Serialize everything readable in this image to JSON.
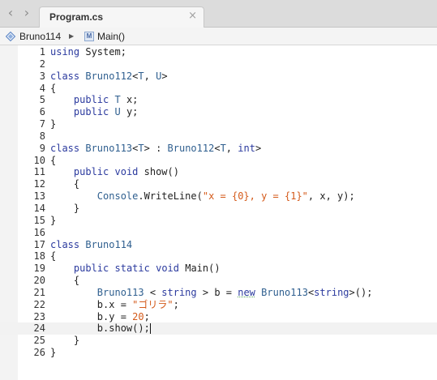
{
  "tabbar": {
    "back_glyph": "‹",
    "forward_glyph": "›",
    "tab_title": "Program.cs",
    "close_glyph": "×"
  },
  "breadcrumb": {
    "namespace": "Bruno114",
    "separator": "▶",
    "method": "Main()",
    "icons": [
      "namespace-icon",
      "method-icon"
    ]
  },
  "colors": {
    "keyword": "#2b3a9e",
    "type": "#2f5f8f",
    "string": "#d45a1a",
    "number": "#d45a1a",
    "plain": "#222222"
  },
  "editor": {
    "current_line": 24,
    "lines": [
      {
        "n": "1",
        "tokens": [
          [
            "kw",
            "using"
          ],
          [
            "p",
            " System;"
          ]
        ]
      },
      {
        "n": "2",
        "tokens": []
      },
      {
        "n": "3",
        "tokens": [
          [
            "kw",
            "class"
          ],
          [
            "p",
            " "
          ],
          [
            "ty",
            "Bruno112"
          ],
          [
            "p",
            "<"
          ],
          [
            "ty",
            "T"
          ],
          [
            "p",
            ", "
          ],
          [
            "ty",
            "U"
          ],
          [
            "p",
            ">"
          ]
        ]
      },
      {
        "n": "4",
        "tokens": [
          [
            "p",
            "{"
          ]
        ]
      },
      {
        "n": "5",
        "tokens": [
          [
            "p",
            "    "
          ],
          [
            "kw",
            "public"
          ],
          [
            "p",
            " "
          ],
          [
            "ty",
            "T"
          ],
          [
            "p",
            " x;"
          ]
        ]
      },
      {
        "n": "6",
        "tokens": [
          [
            "p",
            "    "
          ],
          [
            "kw",
            "public"
          ],
          [
            "p",
            " "
          ],
          [
            "ty",
            "U"
          ],
          [
            "p",
            " y;"
          ]
        ]
      },
      {
        "n": "7",
        "tokens": [
          [
            "p",
            "}"
          ]
        ]
      },
      {
        "n": "8",
        "tokens": []
      },
      {
        "n": "9",
        "tokens": [
          [
            "kw",
            "class"
          ],
          [
            "p",
            " "
          ],
          [
            "ty",
            "Bruno113"
          ],
          [
            "p",
            "<"
          ],
          [
            "ty",
            "T"
          ],
          [
            "p",
            "> : "
          ],
          [
            "ty",
            "Bruno112"
          ],
          [
            "p",
            "<"
          ],
          [
            "ty",
            "T"
          ],
          [
            "p",
            ", "
          ],
          [
            "kw",
            "int"
          ],
          [
            "p",
            ">"
          ]
        ]
      },
      {
        "n": "10",
        "tokens": [
          [
            "p",
            "{"
          ]
        ]
      },
      {
        "n": "11",
        "tokens": [
          [
            "p",
            "    "
          ],
          [
            "kw",
            "public"
          ],
          [
            "p",
            " "
          ],
          [
            "kw",
            "void"
          ],
          [
            "p",
            " show()"
          ]
        ]
      },
      {
        "n": "12",
        "tokens": [
          [
            "p",
            "    {"
          ]
        ]
      },
      {
        "n": "13",
        "tokens": [
          [
            "p",
            "        "
          ],
          [
            "ty",
            "Console"
          ],
          [
            "p",
            ".WriteLine("
          ],
          [
            "str",
            "\"x = {0}, y = {1}\""
          ],
          [
            "p",
            ", x, y);"
          ]
        ]
      },
      {
        "n": "14",
        "tokens": [
          [
            "p",
            "    }"
          ]
        ]
      },
      {
        "n": "15",
        "tokens": [
          [
            "p",
            "}"
          ]
        ]
      },
      {
        "n": "16",
        "tokens": []
      },
      {
        "n": "17",
        "tokens": [
          [
            "kw",
            "class"
          ],
          [
            "p",
            " "
          ],
          [
            "ty",
            "Bruno114"
          ]
        ]
      },
      {
        "n": "18",
        "tokens": [
          [
            "p",
            "{"
          ]
        ]
      },
      {
        "n": "19",
        "tokens": [
          [
            "p",
            "    "
          ],
          [
            "kw",
            "public"
          ],
          [
            "p",
            " "
          ],
          [
            "kw",
            "static"
          ],
          [
            "p",
            " "
          ],
          [
            "kw",
            "void"
          ],
          [
            "p",
            " Main()"
          ]
        ]
      },
      {
        "n": "20",
        "tokens": [
          [
            "p",
            "    {"
          ]
        ]
      },
      {
        "n": "21",
        "tokens": [
          [
            "p",
            "        "
          ],
          [
            "ty",
            "Bruno113"
          ],
          [
            "p",
            " < "
          ],
          [
            "kw",
            "string"
          ],
          [
            "p",
            " > b = "
          ],
          [
            "kwsq",
            "new"
          ],
          [
            "p",
            " "
          ],
          [
            "ty",
            "Bruno113"
          ],
          [
            "p",
            "<"
          ],
          [
            "kw",
            "string"
          ],
          [
            "p",
            ">();"
          ]
        ]
      },
      {
        "n": "22",
        "tokens": [
          [
            "p",
            "        b.x = "
          ],
          [
            "str",
            "\"ゴリラ\""
          ],
          [
            "p",
            ";"
          ]
        ]
      },
      {
        "n": "23",
        "tokens": [
          [
            "p",
            "        b.y = "
          ],
          [
            "num",
            "20"
          ],
          [
            "p",
            ";"
          ]
        ]
      },
      {
        "n": "24",
        "tokens": [
          [
            "p",
            "        b.show();"
          ],
          [
            "caret",
            ""
          ]
        ]
      },
      {
        "n": "25",
        "tokens": [
          [
            "p",
            "    }"
          ]
        ]
      },
      {
        "n": "26",
        "tokens": [
          [
            "p",
            "}"
          ]
        ]
      }
    ]
  }
}
